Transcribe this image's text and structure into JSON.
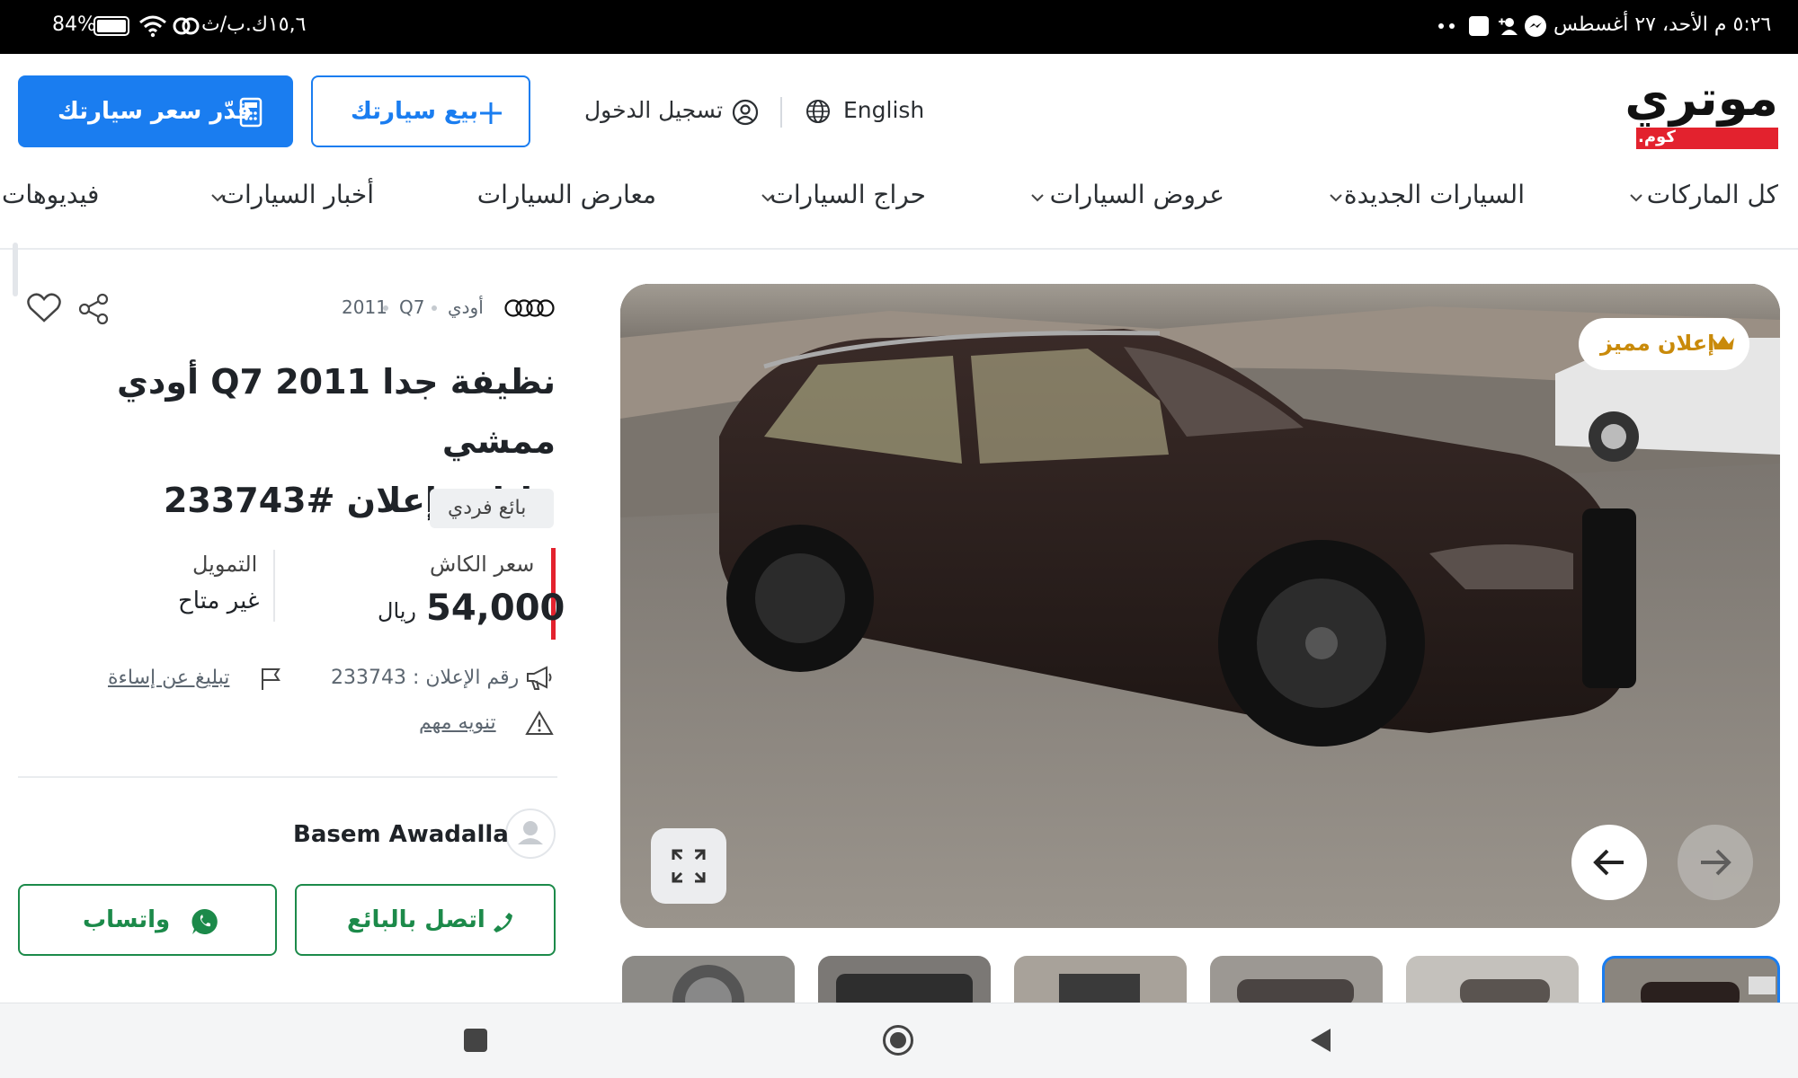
{
  "status_bar": {
    "time_date": "٥:٢٦ م الأحد، ٢٧ أغسطس",
    "speed": "١٥,٦ك.ب/ث",
    "battery": "84%"
  },
  "header": {
    "estimate_button": "قدّر سعر سيارتك",
    "sell_button": "بيع سيارتك",
    "login": "تسجيل الدخول",
    "language": "English",
    "logo_text": "موتري",
    "logo_sub": ".كوم"
  },
  "nav": {
    "items": [
      "كل الماركات",
      "السيارات الجديدة",
      "عروض السيارات",
      "حراج السيارات",
      "معارض السيارات",
      "أخبار السيارات",
      "فيديوهات"
    ]
  },
  "listing": {
    "breadcrumb_make": "أودي",
    "breadcrumb_model": "Q7",
    "breadcrumb_year": "2011",
    "title_line1": "أودي Q7 2011 نظيفة جدا ممشي",
    "title_line2": "قليل - إعلان #233743",
    "seller_type": "بائع فردي",
    "cash_label": "سعر الكاش",
    "price_value": "54,000",
    "price_currency": "ريال",
    "finance_label": "التمويل",
    "finance_value": "غير متاح",
    "ad_number": "رقم الإعلان : 233743",
    "report_abuse": "تبليغ عن إساءة",
    "notice": "تنويه مهم",
    "seller_name": "Basem Awadalla",
    "call_button": "اتصل بالبائع",
    "whatsapp_button": "واتساب",
    "featured_badge": "إعلان مميز"
  },
  "colors": {
    "primary": "#1a7df0",
    "green": "#1c8a4a",
    "brand_red": "#e3222e",
    "featured_gold": "#c98a0a"
  }
}
